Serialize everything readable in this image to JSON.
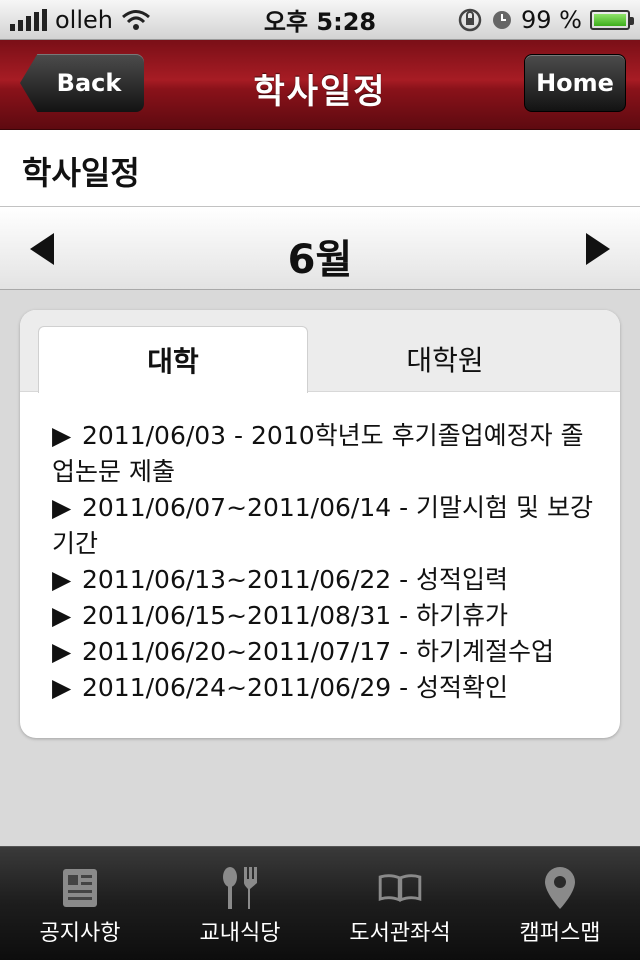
{
  "status_bar": {
    "carrier": "olleh",
    "time": "오후 5:28",
    "battery_percent": "99 %",
    "battery_level": 0.99
  },
  "nav": {
    "title": "학사일정",
    "back_label": "Back",
    "home_label": "Home"
  },
  "section": {
    "title": "학사일정"
  },
  "month": {
    "label": "6월"
  },
  "tabs": [
    {
      "label": "대학",
      "active": true
    },
    {
      "label": "대학원",
      "active": false
    }
  ],
  "schedule": [
    {
      "text": "2011/06/03 - 2010학년도 후기졸업예정자 졸업논문 제출"
    },
    {
      "text": "2011/06/07~2011/06/14 - 기말시험 및 보강 기간"
    },
    {
      "text": "2011/06/13~2011/06/22 - 성적입력"
    },
    {
      "text": "2011/06/15~2011/08/31 - 하기휴가"
    },
    {
      "text": "2011/06/20~2011/07/17 - 하기계절수업"
    },
    {
      "text": "2011/06/24~2011/06/29 - 성적확인"
    }
  ],
  "bullet_glyph": "▶",
  "tab_bar": [
    {
      "label": "공지사항",
      "icon": "notice-icon"
    },
    {
      "label": "교내식당",
      "icon": "cafeteria-icon"
    },
    {
      "label": "도서관좌석",
      "icon": "library-book-icon"
    },
    {
      "label": "캠퍼스맵",
      "icon": "map-pin-icon"
    }
  ]
}
